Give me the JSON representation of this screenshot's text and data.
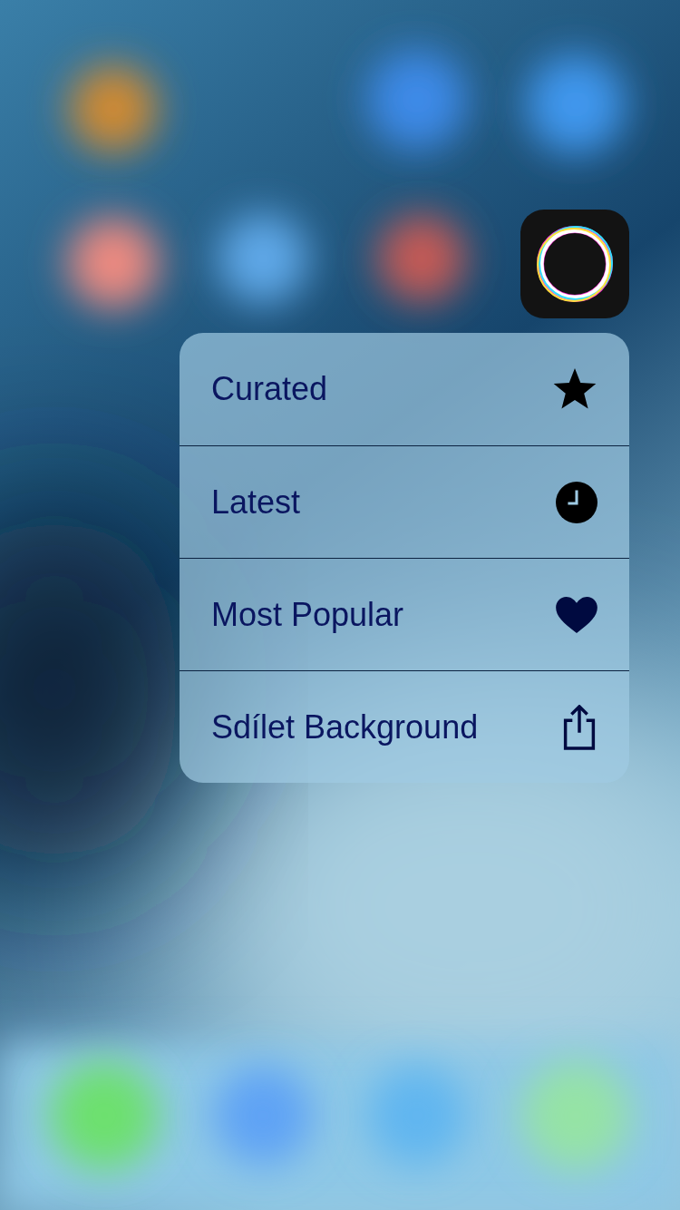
{
  "quick_actions": [
    {
      "label": "Curated",
      "kind": "star"
    },
    {
      "label": "Latest",
      "kind": "clock"
    },
    {
      "label": "Most Popular",
      "kind": "heart"
    },
    {
      "label": "Sdílet Background",
      "kind": "share"
    }
  ]
}
